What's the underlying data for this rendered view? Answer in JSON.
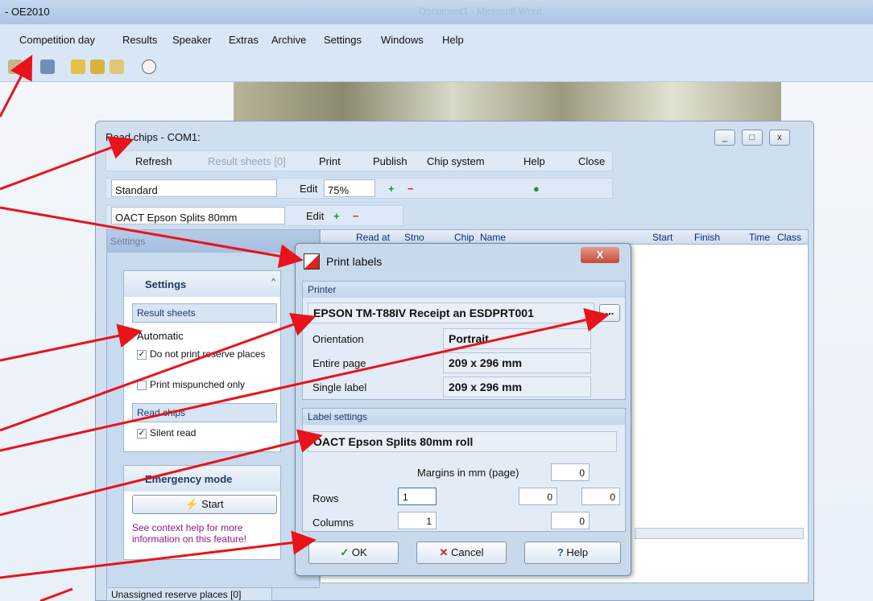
{
  "app": {
    "title": "- OE2010",
    "ghost_title": "Document1 - Microsoft Word"
  },
  "menu": [
    "Competition day",
    "Results",
    "Speaker",
    "Extras",
    "Archive",
    "Settings",
    "Windows",
    "Help"
  ],
  "read_chips": {
    "title": "Read chips - COM1:",
    "toolbar": {
      "refresh": "Refresh",
      "result_sheets": "Result sheets [0]",
      "print": "Print",
      "publish": "Publish",
      "chip_system": "Chip system",
      "help": "Help",
      "close": "Close"
    },
    "layout_select": "Standard",
    "edit1": "Edit",
    "zoom": "75%",
    "label_select": "OACT Epson Splits 80mm",
    "edit2": "Edit",
    "left_panel_header": "Settings",
    "settings_group": {
      "title": "Settings",
      "result_sheets_label": "Result sheets",
      "result_sheets_value": "Automatic",
      "do_not_print": "Do not print reserve places",
      "print_mispunched": "Print mispunched only",
      "read_chips_label": "Read chips",
      "silent_read": "Silent read"
    },
    "emergency": {
      "title": "Emergency mode",
      "start": "Start",
      "help": "See context help for more information on this feature!"
    },
    "unassigned": "Unassigned reserve places [0]",
    "grid_columns": [
      "Read at",
      "Stno",
      "Chip",
      "Name",
      "Start",
      "Finish",
      "Time",
      "Class"
    ]
  },
  "dialog": {
    "title": "Print labels",
    "close": "X",
    "printer_header": "Printer",
    "printer_name": "EPSON TM-T88IV Receipt an ESDPRT001",
    "browse": "...",
    "orientation_label": "Orientation",
    "orientation_value": "Portrait",
    "entire_page_label": "Entire page",
    "entire_page_value": "209 x 296 mm",
    "single_label_label": "Single label",
    "single_label_value": "209 x 296 mm",
    "label_settings_header": "Label settings",
    "label_name": "OACT Epson Splits 80mm roll",
    "margins_label": "Margins in mm (page)",
    "margin_top": "0",
    "rows_label": "Rows",
    "rows_value": "1",
    "margin_left": "0",
    "margin_right": "0",
    "columns_label": "Columns",
    "columns_value": "1",
    "margin_bottom": "0",
    "ok": "OK",
    "cancel": "Cancel",
    "help": "Help"
  },
  "colors": {
    "annotation_arrow": "#e8131b",
    "ok_check": "#2a8a2a",
    "cancel_x": "#c22"
  }
}
